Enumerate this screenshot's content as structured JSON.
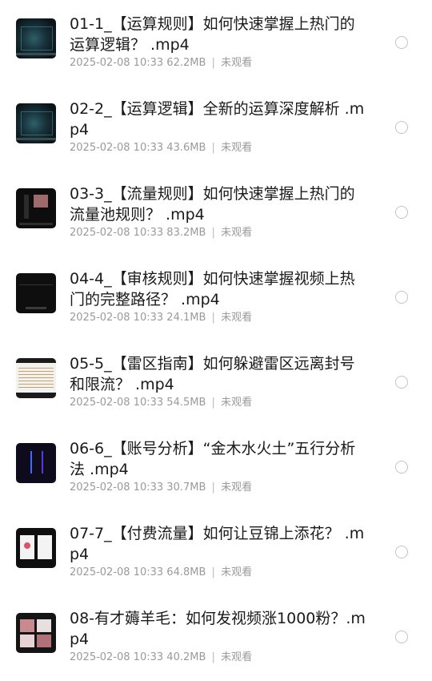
{
  "items": [
    {
      "title": "01-1_【运算规则】如何快速掌握上热门的运算逻辑？ .mp4",
      "date": "2025-02-08 10:33",
      "size": "62.2MB",
      "status": "未观看",
      "thumb_icon": "video-thumbnail-dashboard"
    },
    {
      "title": "02-2_【运算逻辑】全新的运算深度解析 .mp4",
      "date": "2025-02-08 10:33",
      "size": "43.6MB",
      "status": "未观看",
      "thumb_icon": "video-thumbnail-dashboard"
    },
    {
      "title": "03-3_【流量规则】如何快速掌握上热门的流量池规则？ .mp4",
      "date": "2025-02-08 10:33",
      "size": "83.2MB",
      "status": "未观看",
      "thumb_icon": "video-thumbnail-dark-screen"
    },
    {
      "title": "04-4_【审核规则】如何快速掌握视频上热门的完整路径？ .mp4",
      "date": "2025-02-08 10:33",
      "size": "24.1MB",
      "status": "未观看",
      "thumb_icon": "video-thumbnail-dark-screen"
    },
    {
      "title": "05-5_【雷区指南】如何躲避雷区远离封号和限流？ .mp4",
      "date": "2025-02-08 10:33",
      "size": "54.5MB",
      "status": "未观看",
      "thumb_icon": "video-thumbnail-document"
    },
    {
      "title": "06-6_【账号分析】“金木水火土”五行分析法 .mp4",
      "date": "2025-02-08 10:33",
      "size": "30.7MB",
      "status": "未观看",
      "thumb_icon": "video-thumbnail-diagram"
    },
    {
      "title": "07-7_【付费流量】如何让豆锦上添花？ .mp4",
      "date": "2025-02-08 10:33",
      "size": "64.8MB",
      "status": "未观看",
      "thumb_icon": "video-thumbnail-phones"
    },
    {
      "title": "08-有才薅羊毛：如何发视频涨1000粉？.mp4",
      "date": "2025-02-08 10:33",
      "size": "40.2MB",
      "status": "未观看",
      "thumb_icon": "video-thumbnail-collage"
    }
  ],
  "colors": {
    "title": "#1a1a1a",
    "meta": "#9a9a9a",
    "radio_border": "#c4c4c4",
    "background": "#ffffff"
  }
}
